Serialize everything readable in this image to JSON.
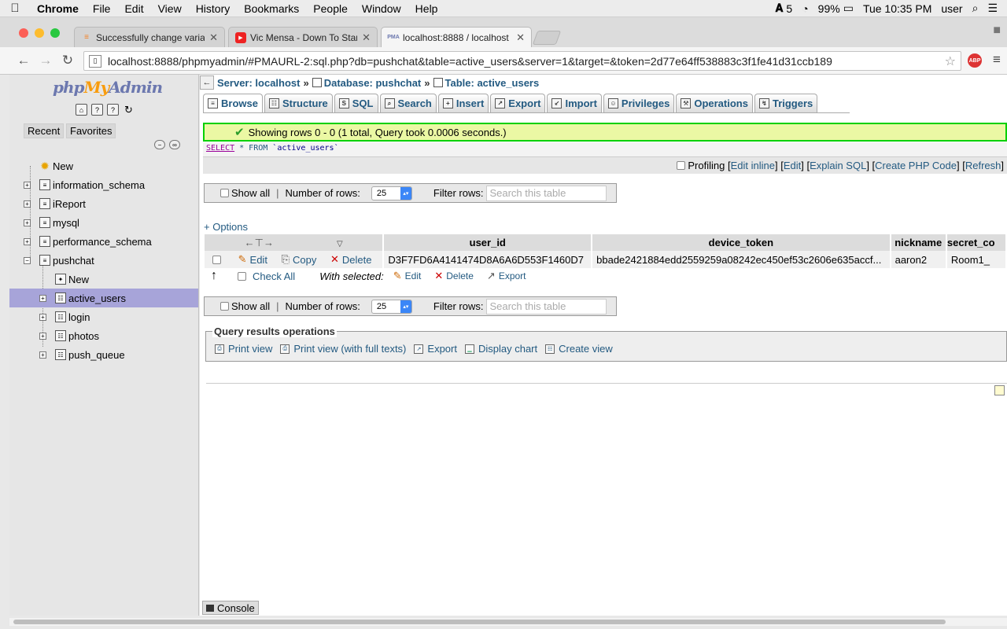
{
  "menubar": {
    "app": "Chrome",
    "items": [
      "File",
      "Edit",
      "View",
      "History",
      "Bookmarks",
      "People",
      "Window",
      "Help"
    ],
    "adobe_count": "5",
    "battery": "99%",
    "clock": "Tue 10:35 PM",
    "user": "user"
  },
  "tabs": [
    {
      "title": "Successfully change variab",
      "favicon": "stack-icon"
    },
    {
      "title": "Vic Mensa - Down To Start",
      "favicon": "youtube-icon"
    },
    {
      "title": "localhost:8888 / localhost",
      "favicon": "pma-icon",
      "favicon_text": "PMA"
    }
  ],
  "address": {
    "url": "localhost:8888/phpmyadmin/#PMAURL-2:sql.php?db=pushchat&table=active_users&server=1&target=&token=2d77e64ff538883c3f1fe41d31ccb189",
    "abp": "ABP"
  },
  "sidebar": {
    "logo_php": "php",
    "logo_my": "My",
    "logo_admin": "Admin",
    "recent": "Recent",
    "favorites": "Favorites",
    "tree": [
      {
        "label": "New"
      },
      {
        "label": "information_schema"
      },
      {
        "label": "iReport"
      },
      {
        "label": "mysql"
      },
      {
        "label": "performance_schema"
      },
      {
        "label": "pushchat"
      },
      {
        "label": "New"
      },
      {
        "label": "active_users"
      },
      {
        "label": "login"
      },
      {
        "label": "photos"
      },
      {
        "label": "push_queue"
      }
    ]
  },
  "breadcrumb": {
    "server": "Server: localhost",
    "database": "Database: pushchat",
    "table": "Table: active_users",
    "sep": "»"
  },
  "topmenu": [
    "Browse",
    "Structure",
    "SQL",
    "Search",
    "Insert",
    "Export",
    "Import",
    "Privileges",
    "Operations",
    "Triggers"
  ],
  "message": {
    "success": "Showing rows 0 - 0 (1 total, Query took 0.0006 seconds.)",
    "sql_select": "SELECT",
    "sql_rest": " * FROM ",
    "sql_table": "`active_users`"
  },
  "links": {
    "profiling": "Profiling",
    "edit_inline": "Edit inline",
    "edit": "Edit",
    "explain": "Explain SQL",
    "php_code": "Create PHP Code",
    "refresh": "Refresh"
  },
  "nav": {
    "show_all": "Show all",
    "number_of_rows": "Number of rows:",
    "rows_value": "25",
    "filter_rows": "Filter rows:",
    "filter_placeholder": "Search this table"
  },
  "options": "+ Options",
  "table": {
    "columns": [
      "user_id",
      "device_token",
      "nickname",
      "secret_co"
    ],
    "row": {
      "edit": "Edit",
      "copy": "Copy",
      "delete": "Delete",
      "user_id": "D3F7FD6A4141474D8A6A6D553F1460D7",
      "device_token": "bbade2421884edd2559259a08242ec450ef53c2606e635accf...",
      "nickname": "aaron2",
      "secret_code": "Room1_"
    }
  },
  "withsel": {
    "check_all": "Check All",
    "with_selected": "With selected:",
    "edit": "Edit",
    "delete": "Delete",
    "export": "Export"
  },
  "qro": {
    "legend": "Query results operations",
    "print": "Print view",
    "print_full": "Print view (with full texts)",
    "export": "Export",
    "chart": "Display chart",
    "view": "Create view"
  },
  "console": "Console"
}
